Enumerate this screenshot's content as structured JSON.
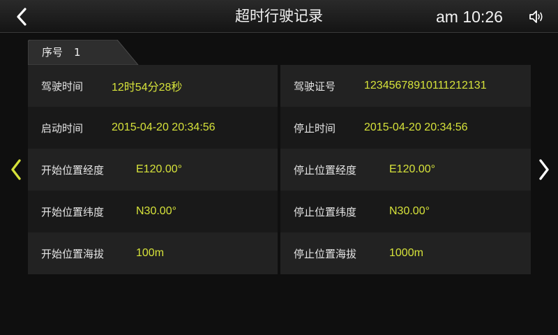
{
  "header": {
    "title": "超时行驶记录",
    "time": "am 10:26"
  },
  "icons": {
    "back": "back-chevron-icon",
    "volume": "speaker-icon",
    "prev": "prev-chevron-icon",
    "next": "next-chevron-icon"
  },
  "colors": {
    "value_text": "#d6e23a",
    "prev_arrow": "#d6e23a",
    "next_arrow": "#ffffff"
  },
  "record": {
    "index_label": "序号",
    "index_value": "1",
    "rows": [
      {
        "left_label": "驾驶时间",
        "left_value": "12时54分28秒",
        "right_label": "驾驶证号",
        "right_value": "12345678910111212131"
      },
      {
        "left_label": "启动时间",
        "left_value": "2015-04-20  20:34:56",
        "right_label": "停止时间",
        "right_value": "2015-04-20  20:34:56"
      },
      {
        "left_label": "开始位置经度",
        "left_value": "E120.00°",
        "right_label": "停止位置经度",
        "right_value": "E120.00°"
      },
      {
        "left_label": "开始位置纬度",
        "left_value": "N30.00°",
        "right_label": "停止位置纬度",
        "right_value": "N30.00°"
      },
      {
        "left_label": "开始位置海拔",
        "left_value": "100m",
        "right_label": "停止位置海拔",
        "right_value": "1000m"
      }
    ]
  }
}
